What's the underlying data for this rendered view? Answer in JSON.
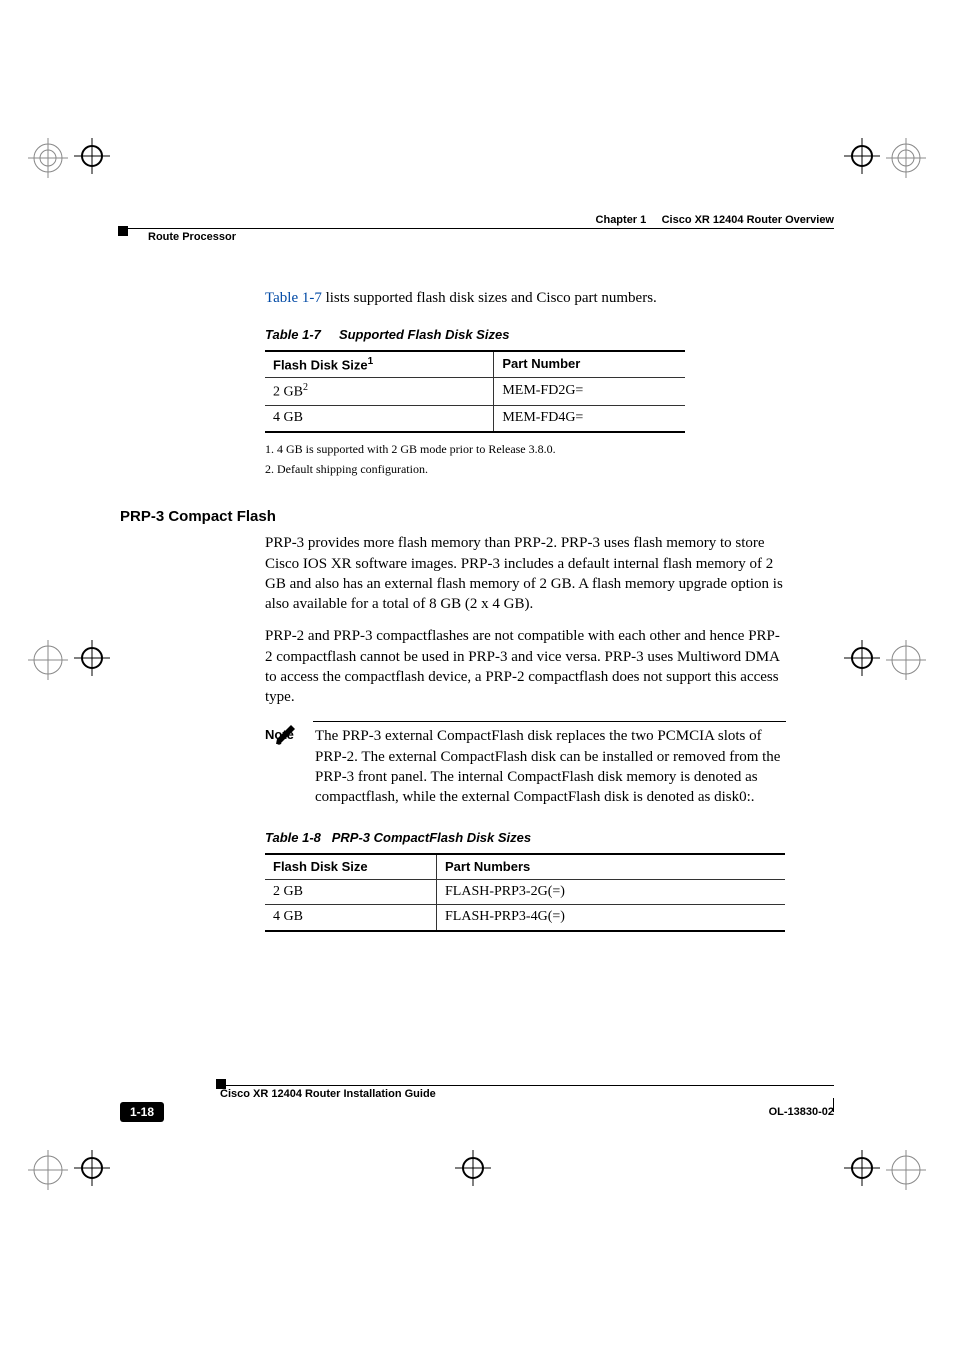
{
  "header": {
    "chapter_label": "Chapter 1",
    "chapter_title": "Cisco XR 12404 Router Overview",
    "section": "Route Processor"
  },
  "intro_line_link": "Table 1-7",
  "intro_line_rest": " lists supported flash disk sizes and Cisco part numbers.",
  "table1": {
    "caption_num": "Table 1-7",
    "caption_title": "Supported Flash Disk Sizes",
    "head_col1": "Flash Disk Size",
    "head_col1_sup": "1",
    "head_col2": "Part Number",
    "rows": [
      {
        "size": "2 GB",
        "size_sup": "2",
        "part": "MEM-FD2G="
      },
      {
        "size": "4 GB",
        "size_sup": "",
        "part": "MEM-FD4G="
      }
    ],
    "footnotes": [
      "1.   4 GB is supported with 2 GB mode prior to Release 3.8.0.",
      "2.   Default shipping configuration."
    ]
  },
  "section_heading": "PRP-3 Compact Flash",
  "paragraph1": "PRP-3 provides more flash memory than PRP-2. PRP-3 uses flash memory to store Cisco IOS XR software images. PRP-3 includes a default internal flash memory of 2 GB and also has an external flash memory of 2 GB. A flash memory upgrade option is also available for a total of 8 GB (2 x 4 GB).",
  "paragraph2": "PRP-2 and PRP-3 compactflashes are not compatible with each other and hence PRP-2 compactflash cannot be used in PRP-3 and vice versa. PRP-3 uses Multiword DMA to access the compactflash device, a PRP-2 compactflash does not support this access type.",
  "note": {
    "label": "Note",
    "text": "The PRP-3 external CompactFlash disk replaces the two PCMCIA slots of PRP-2. The external CompactFlash disk can be installed or removed from the PRP-3 front panel. The internal CompactFlash disk memory is denoted as compactflash, while the external CompactFlash disk is denoted as disk0:."
  },
  "table2": {
    "caption_num": "Table 1-8",
    "caption_title": "PRP-3 CompactFlash Disk Sizes",
    "head_col1": "Flash Disk Size",
    "head_col2": "Part Numbers",
    "rows": [
      {
        "size": "2 GB",
        "part": "FLASH-PRP3-2G(=)"
      },
      {
        "size": "4 GB",
        "part": "FLASH-PRP3-4G(=)"
      }
    ]
  },
  "footer": {
    "guide_title": "Cisco XR 12404 Router Installation Guide",
    "page_num": "1-18",
    "doc_id": "OL-13830-02"
  }
}
